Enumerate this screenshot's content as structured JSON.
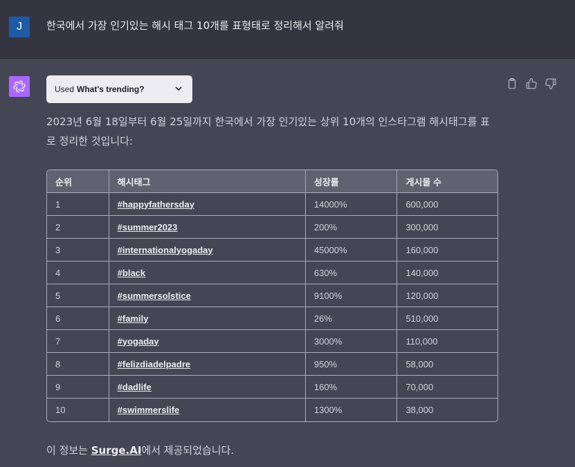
{
  "user_message": {
    "avatar_letter": "J",
    "text": "한국에서 가장 인기있는 해시 태그 10개를 표형태로 정리해서 알려줘"
  },
  "assistant": {
    "plugin": {
      "used_label": "Used",
      "name": "What's trending?"
    },
    "intro": "2023년 6월 18일부터 6월 25일까지 한국에서 가장 인기있는 상위 10개의 인스타그램 해시태그를 표로 정리한 것입니다:",
    "table": {
      "headers": [
        "순위",
        "해시태그",
        "성장률",
        "게시물 수"
      ],
      "rows": [
        [
          "1",
          "#happyfathersday",
          "14000%",
          "600,000"
        ],
        [
          "2",
          "#summer2023",
          "200%",
          "300,000"
        ],
        [
          "3",
          "#internationalyogaday",
          "45000%",
          "160,000"
        ],
        [
          "4",
          "#black",
          "630%",
          "140,000"
        ],
        [
          "5",
          "#summersolstice",
          "9100%",
          "120,000"
        ],
        [
          "6",
          "#family",
          "26%",
          "510,000"
        ],
        [
          "7",
          "#yogaday",
          "3000%",
          "110,000"
        ],
        [
          "8",
          "#felizdiadelpadre",
          "950%",
          "58,000"
        ],
        [
          "9",
          "#dadlife",
          "160%",
          "70,000"
        ],
        [
          "10",
          "#swimmerslife",
          "1300%",
          "38,000"
        ]
      ]
    },
    "outro": {
      "before": "이 정보는 ",
      "link": "Surge.AI",
      "after": "에서 제공되었습니다."
    },
    "icons": [
      "clipboard-icon",
      "thumbs-up-icon",
      "thumbs-down-icon"
    ]
  },
  "colors": {
    "user_bg": "#343541",
    "assistant_bg": "#444654",
    "bot_avatar": "#ab68ff",
    "user_avatar": "#1f5aa6",
    "table_header": "#60626f"
  }
}
